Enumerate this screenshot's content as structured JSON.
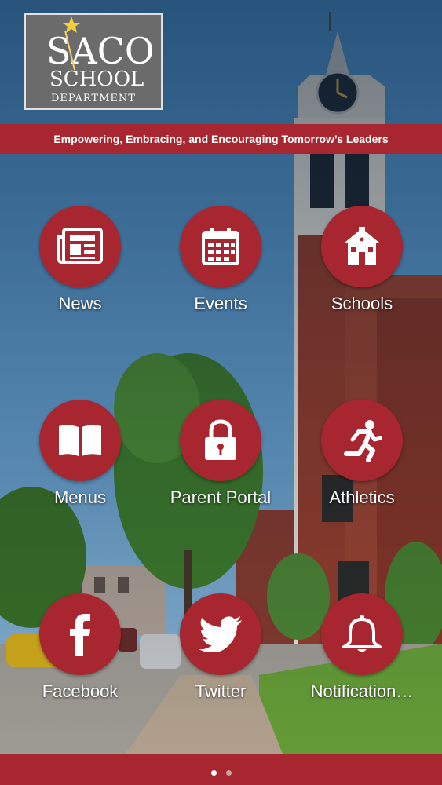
{
  "logo": {
    "line1": "SACO",
    "line2": "SCHOOL",
    "line3": "DEPARTMENT"
  },
  "tagline": "Empowering, Embracing, and Encouraging Tomorrow’s Leaders",
  "tiles": [
    {
      "label": "News",
      "icon": "newspaper-icon"
    },
    {
      "label": "Events",
      "icon": "calendar-icon"
    },
    {
      "label": "Schools",
      "icon": "schoolhouse-icon"
    },
    {
      "label": "Menus",
      "icon": "book-icon"
    },
    {
      "label": "Parent Portal",
      "icon": "lock-icon"
    },
    {
      "label": "Athletics",
      "icon": "runner-icon"
    },
    {
      "label": "Facebook",
      "icon": "facebook-icon"
    },
    {
      "label": "Twitter",
      "icon": "twitter-icon"
    },
    {
      "label": "Notification…",
      "icon": "bell-icon"
    }
  ],
  "pager": {
    "pages": 2,
    "current": 1
  },
  "colors": {
    "brand": "#a8262f",
    "sky": "#4a90d9"
  }
}
